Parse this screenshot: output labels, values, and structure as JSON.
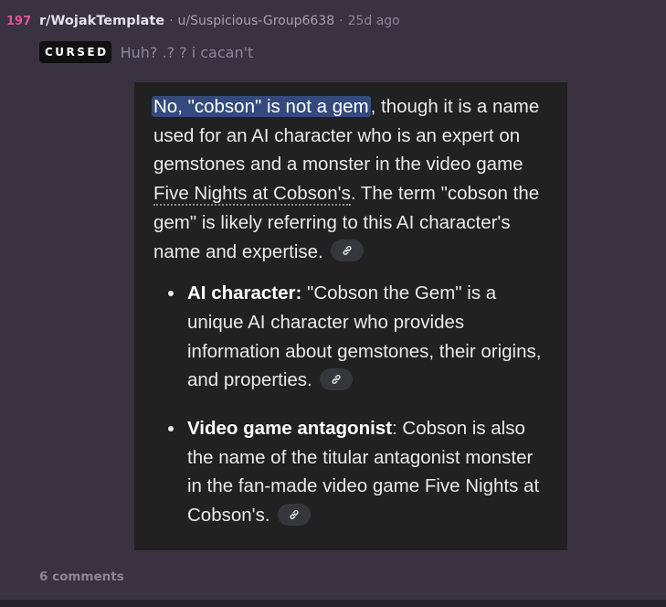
{
  "post": {
    "score": "197",
    "subreddit": "r/WojakTemplate",
    "separator": "·",
    "user": "u/Suspicious-Group6638",
    "age": "25d ago",
    "flair": "CURSED",
    "title": "Huh? .? ? i cacan't",
    "comments": "6 comments"
  },
  "answer": {
    "highlight": "No, \"cobson\" is not a gem",
    "p1a": ", though it is a name used for an AI character who is an expert on gemstones and a monster in the video game ",
    "p1link": "Five Nights at Cobson's",
    "p1b": ". The term \"cobson the gem\" is likely referring to this AI character's name and expertise.",
    "bullets": [
      {
        "term": "AI character",
        "termSuffix": ":",
        "text": " \"Cobson the Gem\" is a unique AI character who provides information about gemstones, their origins, and properties."
      },
      {
        "term": "Video game antagonist",
        "termSuffix": ":",
        "text": " Cobson is also the name of the titular antagonist monster in the fan-made video game Five Nights at Cobson's."
      }
    ],
    "citation_icon": "link-icon"
  },
  "colors": {
    "score": "#e0559b",
    "background": "#3a3240",
    "panel": "#212121",
    "highlight": "#354a7c"
  }
}
